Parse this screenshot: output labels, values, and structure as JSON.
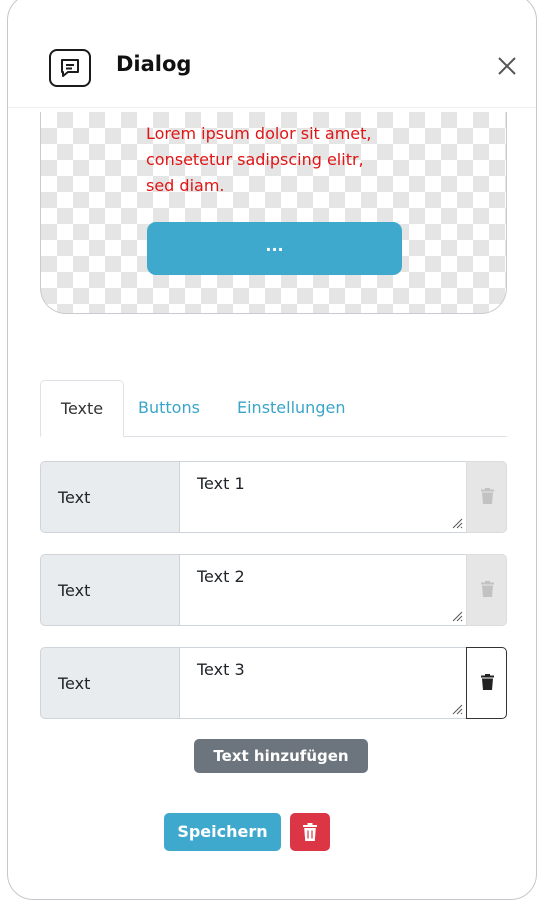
{
  "dialog": {
    "title": "Dialog",
    "icon": "chat-icon",
    "close_icon": "close-icon"
  },
  "preview": {
    "text_lines": [
      "Lorem ipsum dolor sit amet,",
      "consetetur sadipscing elitr,",
      "sed diam."
    ],
    "button_label": "...",
    "text_color": "#e01515",
    "button_color": "#3ea9cd"
  },
  "tabs": [
    {
      "label": "Texte",
      "active": true
    },
    {
      "label": "Buttons",
      "active": false
    },
    {
      "label": "Einstellungen",
      "active": false
    }
  ],
  "rows": [
    {
      "label": "Text",
      "value": "Text 1",
      "delete_enabled": false
    },
    {
      "label": "Text",
      "value": "Text 2",
      "delete_enabled": false
    },
    {
      "label": "Text",
      "value": "Text 3",
      "delete_enabled": true
    }
  ],
  "actions": {
    "add_label": "Text hinzufügen",
    "save_label": "Speichern",
    "delete_icon": "trash-icon"
  }
}
